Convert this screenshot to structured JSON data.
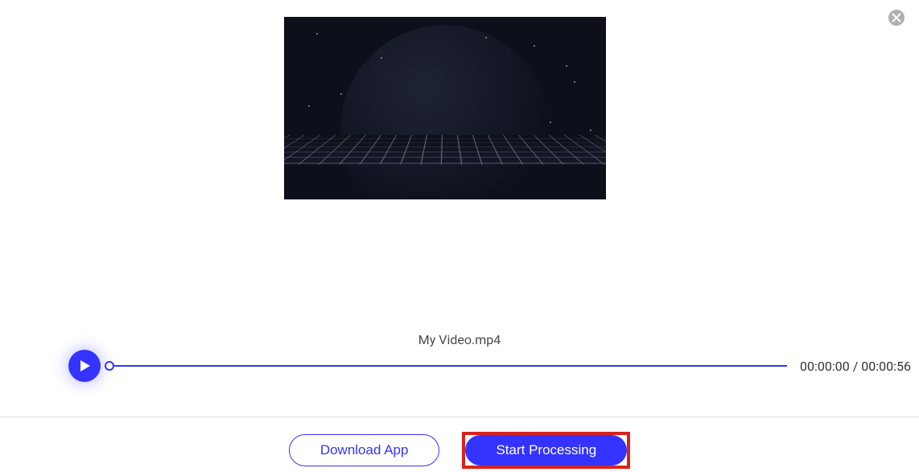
{
  "filename": "My Video.mp4",
  "time": {
    "current": "00:00:00",
    "total": "00:00:56",
    "separator": " / "
  },
  "actions": {
    "download": "Download App",
    "process": "Start Processing"
  }
}
